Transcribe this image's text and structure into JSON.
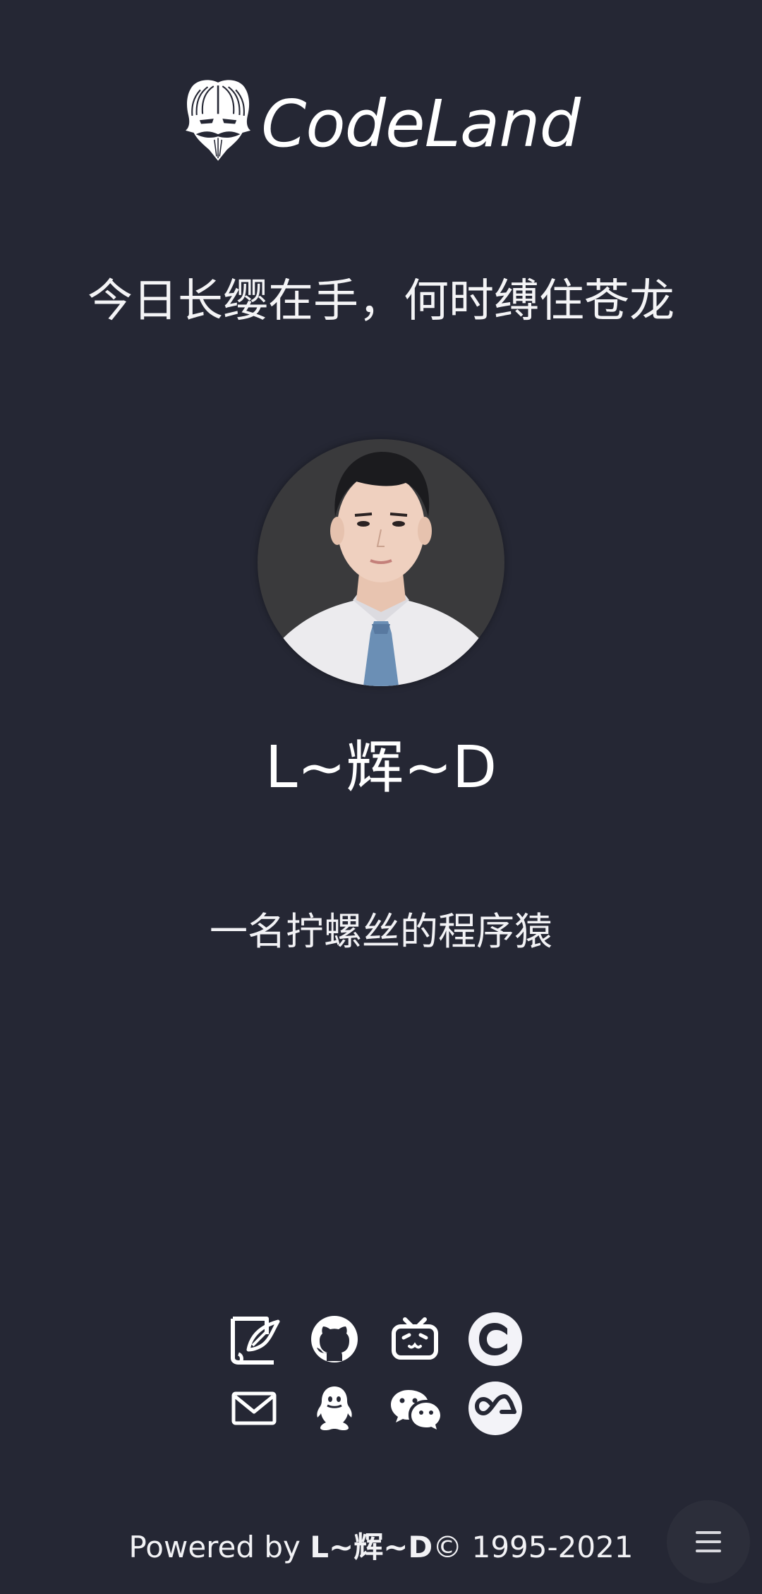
{
  "header": {
    "brand": "CodeLand",
    "logo_icon": "mask-logo-icon",
    "motto": "今日长缨在手，何时缚住苍龙"
  },
  "profile": {
    "name": "L~辉~D",
    "bio": "一名拧螺丝的程序猿"
  },
  "social": {
    "items": [
      {
        "icon": "blog-icon"
      },
      {
        "icon": "github-icon"
      },
      {
        "icon": "bilibili-icon"
      },
      {
        "icon": "csdn-icon"
      },
      {
        "icon": "email-icon"
      },
      {
        "icon": "qq-icon"
      },
      {
        "icon": "wechat-icon"
      },
      {
        "icon": "juejin-icon"
      }
    ]
  },
  "footer": {
    "prefix": "Powered by ",
    "author": "L~辉~D",
    "suffix": "© 1995-2021"
  },
  "menu": {
    "icon": "menu-icon"
  },
  "colors": {
    "background": "#252734",
    "text": "#f2f2f5",
    "fab": "#2c2e3a"
  }
}
